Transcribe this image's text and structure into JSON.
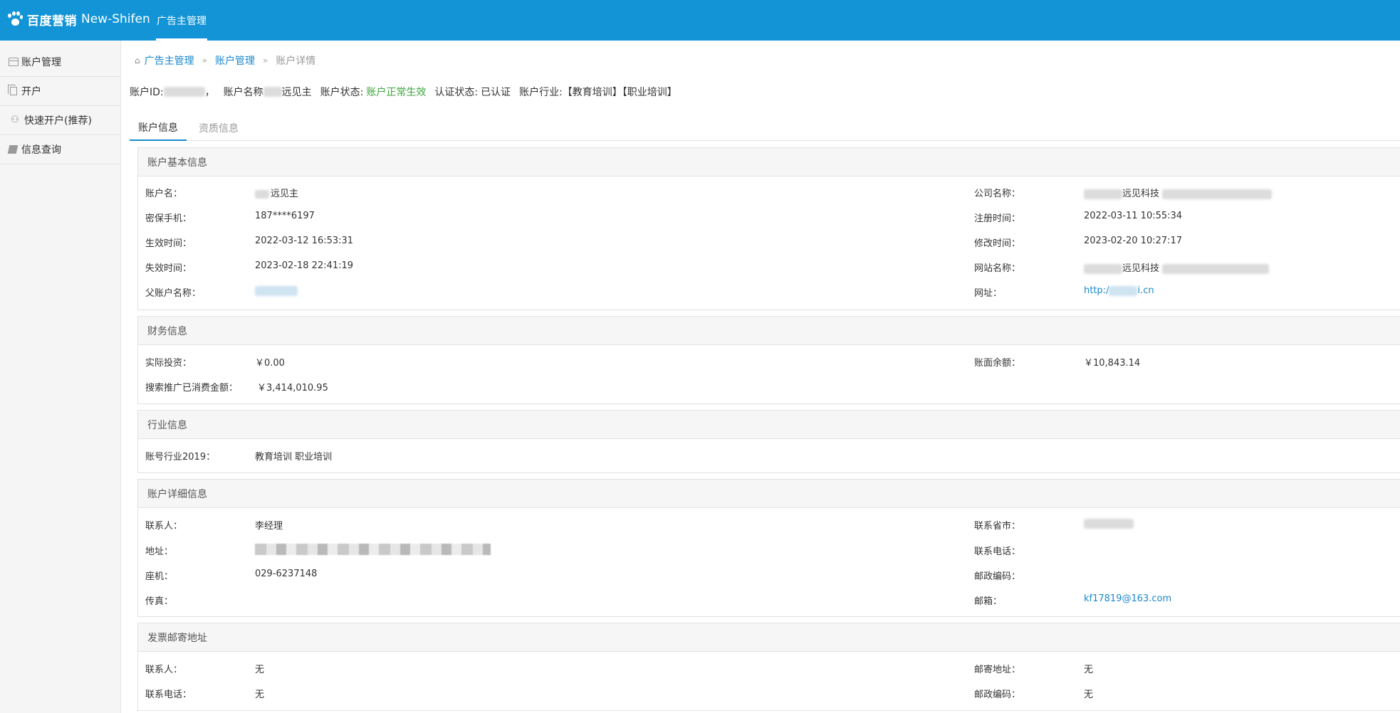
{
  "header": {
    "brand": "百度营销",
    "sub_brand": "New-Shifen",
    "nav_item": "广告主管理"
  },
  "sidebar": {
    "items": [
      {
        "label": "账户管理",
        "icon": "card-icon"
      },
      {
        "label": "开户",
        "icon": "copy-icon"
      },
      {
        "label": "快速开户(推荐)",
        "icon": "bicycle-icon"
      },
      {
        "label": "信息查询",
        "icon": "book-icon"
      }
    ]
  },
  "breadcrumb": {
    "home": "广告主管理",
    "level2": "账户管理",
    "current": "账户详情",
    "separator": "»"
  },
  "summary": {
    "id_label": "账户ID:",
    "id_suffix": "，",
    "name_label": "账户名称",
    "name_value": "远见主",
    "status_label": "账户状态:",
    "status_value": "账户正常生效",
    "cert_label": "认证状态:",
    "cert_value": "已认证",
    "industry_label": "账户行业:",
    "industry_value": "【教育培训】【职业培训】"
  },
  "tabs": [
    "账户信息",
    "资质信息"
  ],
  "basic": {
    "title": "账户基本信息",
    "account_name_label": "账户名：",
    "account_name_value": "远见主",
    "phone_label": "密保手机：",
    "phone_value": "187****6197",
    "effective_label": "生效时间：",
    "effective_value": "2022-03-12 16:53:31",
    "expire_label": "失效时间：",
    "expire_value": "2023-02-18 22:41:19",
    "parent_label": "父账户名称：",
    "company_label": "公司名称：",
    "company_value": "远见科技",
    "register_label": "注册时间：",
    "register_value": "2022-03-11 10:55:34",
    "modify_label": "修改时间：",
    "modify_value": "2023-02-20 10:27:17",
    "site_name_label": "网站名称：",
    "site_name_value": "远见科技",
    "url_label": "网址：",
    "url_prefix": "http:/",
    "url_suffix": "i.cn"
  },
  "finance": {
    "title": "财务信息",
    "invest_label": "实际投资：",
    "invest_value": "￥0.00",
    "consumed_label": "搜索推广已消费金额：",
    "consumed_value": "￥3,414,010.95",
    "balance_label": "账面余额：",
    "balance_value": "￥10,843.14"
  },
  "industry": {
    "title": "行业信息",
    "label": "账号行业2019：",
    "value": "教育培训 职业培训"
  },
  "detail": {
    "title": "账户详细信息",
    "contact_label": "联系人：",
    "contact_value": "李经理",
    "address_label": "地址：",
    "landline_label": "座机：",
    "landline_value": "029-6237148",
    "fax_label": "传真：",
    "province_label": "联系省市：",
    "tel_label": "联系电话：",
    "zip_label": "邮政编码：",
    "email_label": "邮箱：",
    "email_value": "kf17819@163.com"
  },
  "invoice": {
    "title": "发票邮寄地址",
    "contact_label": "联系人：",
    "contact_value": "无",
    "tel_label": "联系电话：",
    "tel_value": "无",
    "mail_addr_label": "邮寄地址：",
    "mail_addr_value": "无",
    "zip_label": "邮政编码：",
    "zip_value": "无"
  },
  "colors": {
    "topbar": "#1294d6",
    "link": "#1a88cc",
    "status_ok": "#3aa53a"
  }
}
